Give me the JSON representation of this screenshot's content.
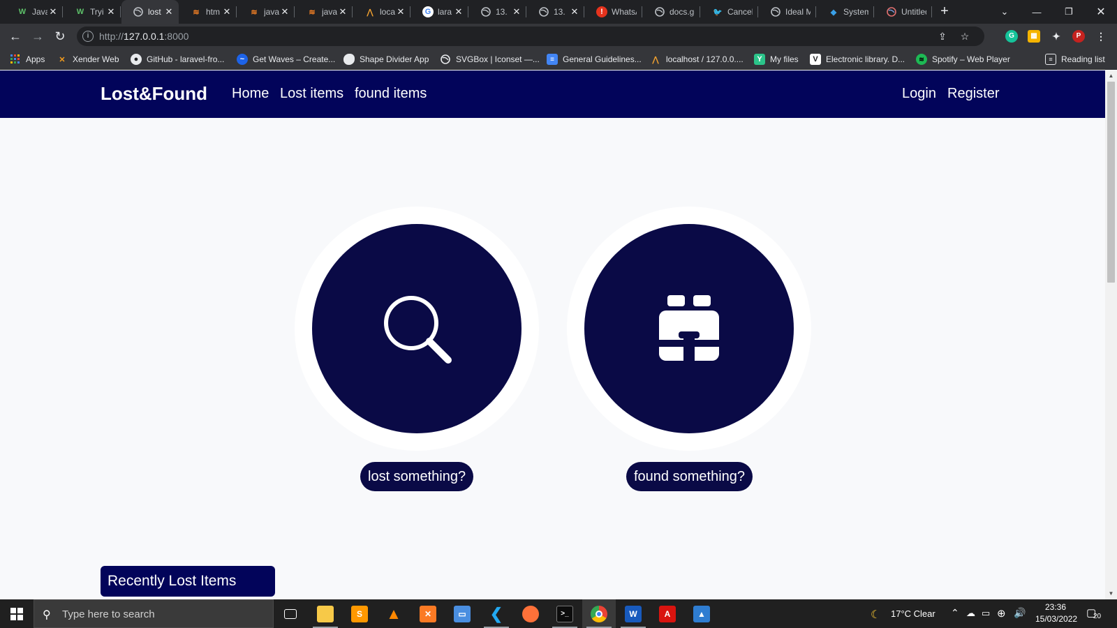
{
  "browser": {
    "tabs": [
      {
        "title": "Java",
        "favicon": "W"
      },
      {
        "title": "Tryi",
        "favicon": "W"
      },
      {
        "title": "lost",
        "favicon": "globe",
        "active": true
      },
      {
        "title": "htm",
        "favicon": "so"
      },
      {
        "title": "java",
        "favicon": "so"
      },
      {
        "title": "java",
        "favicon": "so"
      },
      {
        "title": "loca",
        "favicon": "pma"
      },
      {
        "title": "lara",
        "favicon": "G"
      },
      {
        "title": "13.",
        "favicon": "globe"
      },
      {
        "title": "13.",
        "favicon": "globe"
      },
      {
        "title": "WhatsA",
        "favicon": "!"
      },
      {
        "title": "docs.go",
        "favicon": "globe"
      },
      {
        "title": "Cancelo",
        "favicon": "bird"
      },
      {
        "title": "Ideal M",
        "favicon": "globe"
      },
      {
        "title": "System",
        "favicon": "diamond"
      },
      {
        "title": "Untitled",
        "favicon": "globe"
      }
    ],
    "new_tab": "+",
    "url_scheme": "http://",
    "url_host": "127.0.0.1",
    "url_port": ":8000",
    "profile_initial": "P",
    "bookmarks": [
      {
        "label": "Apps",
        "icon": "grid"
      },
      {
        "label": "Xender Web",
        "icon": "X"
      },
      {
        "label": "GitHub - laravel-fro...",
        "icon": "github"
      },
      {
        "label": "Get Waves – Create...",
        "icon": "wave"
      },
      {
        "label": "Shape Divider App",
        "icon": "blob"
      },
      {
        "label": "SVGBox | Iconset —...",
        "icon": "globe"
      },
      {
        "label": "General Guidelines...",
        "icon": "doc"
      },
      {
        "label": "localhost / 127.0.0....",
        "icon": "pma"
      },
      {
        "label": "My files",
        "icon": "Y"
      },
      {
        "label": "Electronic library. D...",
        "icon": "V"
      },
      {
        "label": "Spotify – Web Player",
        "icon": "spotify"
      }
    ],
    "reading_list": "Reading list"
  },
  "site": {
    "brand": "Lost&Found",
    "nav_links": [
      "Home",
      "Lost items",
      "found items"
    ],
    "auth_links": [
      "Login",
      "Register"
    ],
    "hero": [
      {
        "label": "lost something?",
        "icon": "search-icon"
      },
      {
        "label": "found something?",
        "icon": "binoculars-icon"
      }
    ],
    "recent_heading": "Recently Lost Items",
    "colors": {
      "navbar": "#02045a",
      "circle": "#0a0a46",
      "page_bg": "#f8f9fb"
    }
  },
  "taskbar": {
    "search_placeholder": "Type here to search",
    "weather": "17°C  Clear",
    "time": "23:36",
    "date": "15/03/2022",
    "notifications": "20"
  }
}
